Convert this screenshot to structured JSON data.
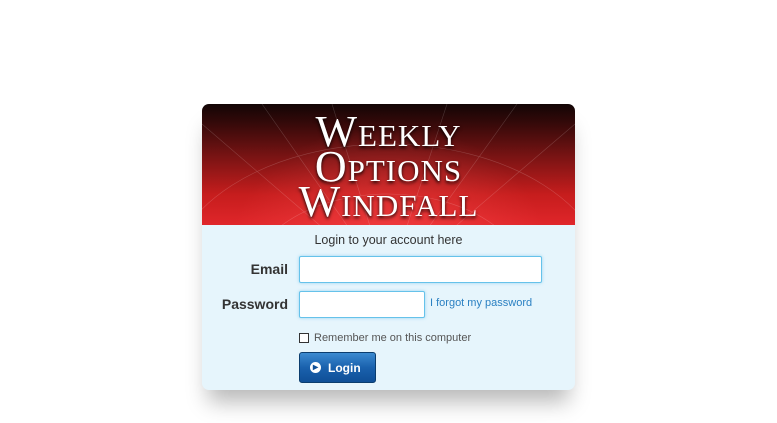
{
  "brand": {
    "logo_line1": "Weekly",
    "logo_line2": "Options",
    "logo_line3": "Windfall"
  },
  "form": {
    "subtitle": "Login to your account here",
    "email_label": "Email",
    "email_value": "",
    "password_label": "Password",
    "password_value": "",
    "forgot_link": "I forgot my password",
    "remember_label": "Remember me on this computer",
    "remember_checked": false,
    "login_button": "Login"
  },
  "icons": {
    "login_button_icon": "arrow-right-circle-icon"
  },
  "colors": {
    "banner_dark": "#120505",
    "banner_red": "#e0262a",
    "panel_background": "#e6f5fc",
    "input_border": "#66c2ea",
    "link": "#2a80c2",
    "button": "#1a61ad"
  }
}
